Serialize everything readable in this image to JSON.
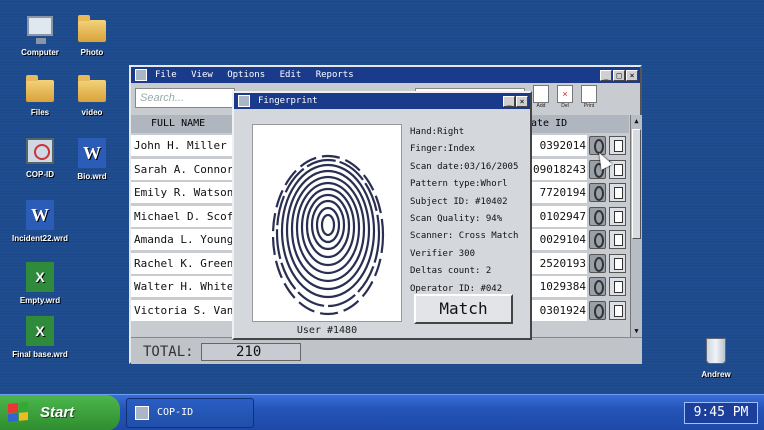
{
  "desktop": {
    "icons": [
      {
        "label": "Computer"
      },
      {
        "label": "Photo"
      },
      {
        "label": "Files"
      },
      {
        "label": "video"
      },
      {
        "label": "COP-ID"
      },
      {
        "label": "Bio.wrd"
      },
      {
        "label": "Incident22.wrd"
      },
      {
        "label": "Empty.wrd"
      },
      {
        "label": "Final base.wrd"
      },
      {
        "label": "Andrew"
      }
    ]
  },
  "main_window": {
    "menu": [
      "File",
      "View",
      "Options",
      "Edit",
      "Reports"
    ],
    "search_placeholder": "Search...",
    "toolbar": [
      "Add",
      "Del",
      "Print"
    ],
    "columns": {
      "name": "FULL NAME",
      "date_id": "ate ID"
    },
    "rows": [
      {
        "name": "John H. Miller",
        "date_id": "0392014"
      },
      {
        "name": "Sarah A. Connor",
        "date_id": "09018243"
      },
      {
        "name": "Emily R. Watson",
        "date_id": "7720194"
      },
      {
        "name": "Michael D. Scof",
        "date_id": "0102947"
      },
      {
        "name": "Amanda L. Young",
        "date_id": "0029104"
      },
      {
        "name": "Rachel K. Green",
        "date_id": "2520193"
      },
      {
        "name": "Walter H. White",
        "date_id": "1029384"
      },
      {
        "name": "Victoria S. Van",
        "date_id": "0301924"
      }
    ],
    "total_label": "TOTAL:",
    "total_value": "210"
  },
  "dialog": {
    "title": "Fingerprint",
    "caption": "User #1480",
    "info": [
      "Hand:Right",
      "Finger:Index",
      "Scan date:03/16/2005",
      "Pattern type:Whorl",
      "Subject ID: #10402",
      "Scan Quality: 94%",
      "Scanner: Cross Match",
      "Verifier 300",
      "Deltas count: 2",
      "Operator ID: #042"
    ],
    "match_label": "Match"
  },
  "taskbar": {
    "start_label": "Start",
    "task_label": "COP-ID",
    "clock": "9:45 PM"
  },
  "colors": {
    "desktop": "#1d4a8c",
    "titlebar": "#1a3a8c",
    "taskbar": "#2454b8",
    "start": "#2e8c2e"
  }
}
